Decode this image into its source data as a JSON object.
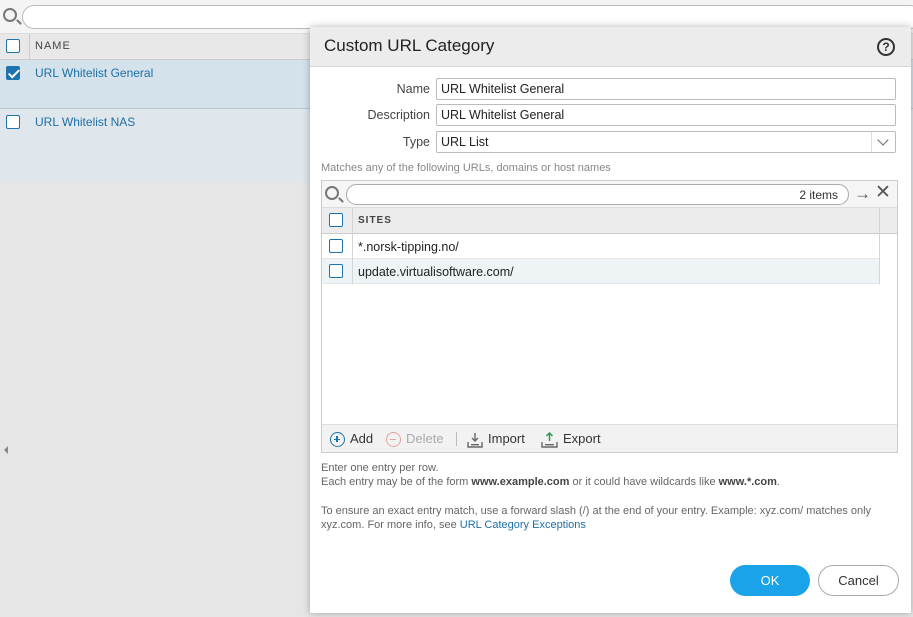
{
  "background": {
    "column_header": "NAME",
    "rows": [
      {
        "label": "URL Whitelist General",
        "checked": true
      },
      {
        "label": "URL Whitelist NAS",
        "checked": false
      }
    ]
  },
  "dialog": {
    "title": "Custom URL Category",
    "help_glyph": "?",
    "fields": {
      "name_label": "Name",
      "name_value": "URL Whitelist General",
      "description_label": "Description",
      "description_value": "URL Whitelist General",
      "type_label": "Type",
      "type_value": "URL List"
    },
    "matches_hint": "Matches any of the following URLs, domains or host names",
    "sites_panel": {
      "item_count": "2 items",
      "column_header": "SITES",
      "rows": [
        "*.norsk-tipping.no/",
        "update.virtualisoftware.com/"
      ],
      "toolbar": {
        "add": "Add",
        "delete": "Delete",
        "import": "Import",
        "export": "Export"
      }
    },
    "hint_line1": "Enter one entry per row.",
    "hint_line2_prefix": "Each entry may be of the form ",
    "hint_line2_example1": "www.example.com",
    "hint_line2_middle": " or it could have wildcards like ",
    "hint_line2_example2": "www.*.com",
    "hint_line2_suffix": ".",
    "hint_exact": "To ensure an exact entry match, use a forward slash (/) at the end of your entry. Example: xyz.com/ matches only xyz.com. For more info, see ",
    "hint_link": "URL Category Exceptions",
    "ok_label": "OK",
    "cancel_label": "Cancel"
  },
  "colors": {
    "accent": "#1d73ad",
    "ok_button": "#1aa3e8"
  }
}
